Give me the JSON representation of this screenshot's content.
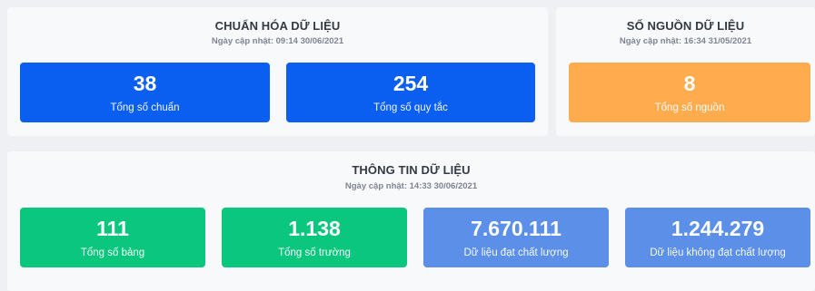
{
  "standardization": {
    "title": "CHUẨN HÓA DỮ LIỆU",
    "updated": "Ngày cập nhật: 09:14 30/06/2021",
    "cards": [
      {
        "value": "38",
        "label": "Tổng số chuẩn"
      },
      {
        "value": "254",
        "label": "Tổng số quy tắc"
      }
    ]
  },
  "sources": {
    "title": "SỐ NGUỒN DỮ LIỆU",
    "updated": "Ngày cập nhật: 16:34 31/05/2021",
    "cards": [
      {
        "value": "8",
        "label": "Tổng số nguồn"
      }
    ]
  },
  "data_info": {
    "title": "THÔNG TIN DỮ LIỆU",
    "updated": "Ngày cập nhật: 14:33 30/06/2021",
    "cards": [
      {
        "value": "111",
        "label": "Tổng số bảng"
      },
      {
        "value": "1.138",
        "label": "Tổng số trường"
      },
      {
        "value": "7.670.111",
        "label": "Dữ liệu đạt chất lượng"
      },
      {
        "value": "1.244.279",
        "label": "Dữ liệu không đạt chất lượng"
      }
    ]
  },
  "colors": {
    "blue": "#0a5ff0",
    "orange": "#ffac4f",
    "green": "#0bc77e",
    "light_blue": "#5b8fe8"
  }
}
